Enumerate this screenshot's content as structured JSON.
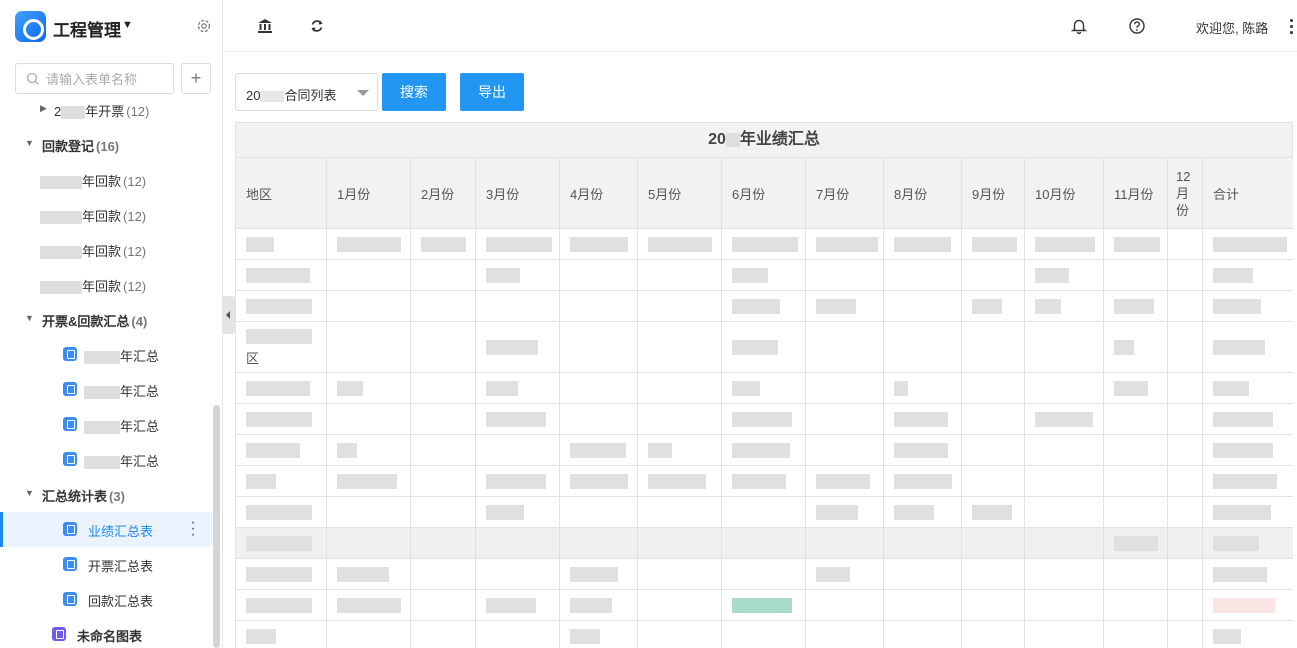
{
  "app": {
    "title": "工程管理"
  },
  "sidebar": {
    "search_placeholder": "请输入表单名称",
    "add_label": "+",
    "items": [
      {
        "type": "sub",
        "text": "年开票",
        "count": "(12)"
      },
      {
        "type": "group",
        "text": "回款登记",
        "count": "(16)"
      },
      {
        "type": "sub",
        "text": "年回款",
        "count": "(12)"
      },
      {
        "type": "sub",
        "text": "年回款",
        "count": "(12)"
      },
      {
        "type": "sub",
        "text": "年回款",
        "count": "(12)"
      },
      {
        "type": "sub",
        "text": "年回款",
        "count": "(12)"
      },
      {
        "type": "group",
        "text": "开票&回款汇总",
        "count": "(4)"
      },
      {
        "type": "form",
        "text": "年汇总"
      },
      {
        "type": "form",
        "text": "年汇总"
      },
      {
        "type": "form",
        "text": "年汇总"
      },
      {
        "type": "form",
        "text": "年汇总"
      },
      {
        "type": "group",
        "text": "汇总统计表",
        "count": "(3)"
      },
      {
        "type": "form",
        "text": "业绩汇总表",
        "active": true
      },
      {
        "type": "form",
        "text": "开票汇总表"
      },
      {
        "type": "form",
        "text": "回款汇总表"
      },
      {
        "type": "chart",
        "text": "未命名图表"
      }
    ]
  },
  "header": {
    "welcome": "欢迎您, 陈路"
  },
  "toolbar": {
    "select_value": "20",
    "select_value_suffix": "合同列表",
    "search_label": "搜索",
    "export_label": "导出"
  },
  "table": {
    "title_prefix": "20",
    "title_suffix": "年业绩汇总",
    "columns": [
      "地区",
      "1月份",
      "2月份",
      "3月份",
      "4月份",
      "5月份",
      "6月份",
      "7月份",
      "8月份",
      "9月份",
      "10月份",
      "11月份",
      "12月份",
      "合计"
    ],
    "row4_suffix": "区"
  },
  "colors": {
    "accent": "#1e88f0",
    "button": "#2196f3"
  }
}
